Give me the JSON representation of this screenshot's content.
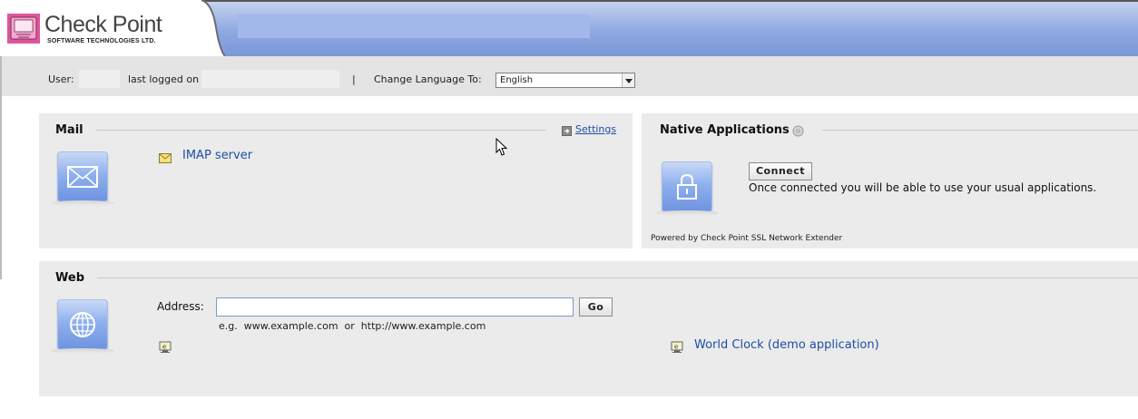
{
  "header": {
    "brand_name": "Check Point",
    "brand_subtitle": "SOFTWARE TECHNOLOGIES LTD."
  },
  "userbar": {
    "user_label": "User:",
    "last_logged_label": "last logged on",
    "separator": "|",
    "change_language_label": "Change Language To:",
    "language_selected": "English"
  },
  "mail": {
    "title": "Mail",
    "settings_label": "Settings",
    "imap_label": "IMAP server"
  },
  "native": {
    "title": "Native Applications",
    "connect_label": "Connect",
    "description": "Once connected you will be able to use your usual applications.",
    "powered_by": "Powered by Check Point SSL Network Extender"
  },
  "web": {
    "title": "Web",
    "address_label": "Address:",
    "address_value": "",
    "go_label": "Go",
    "example_text": "e.g.  www.example.com  or  http://www.example.com",
    "world_clock_label": "World Clock (demo application)"
  },
  "colors": {
    "link": "#1d4fa3",
    "panel_bg": "#ebebeb",
    "header_blue": "#8ea8e2",
    "icon_blue": "#8fb0ee"
  }
}
